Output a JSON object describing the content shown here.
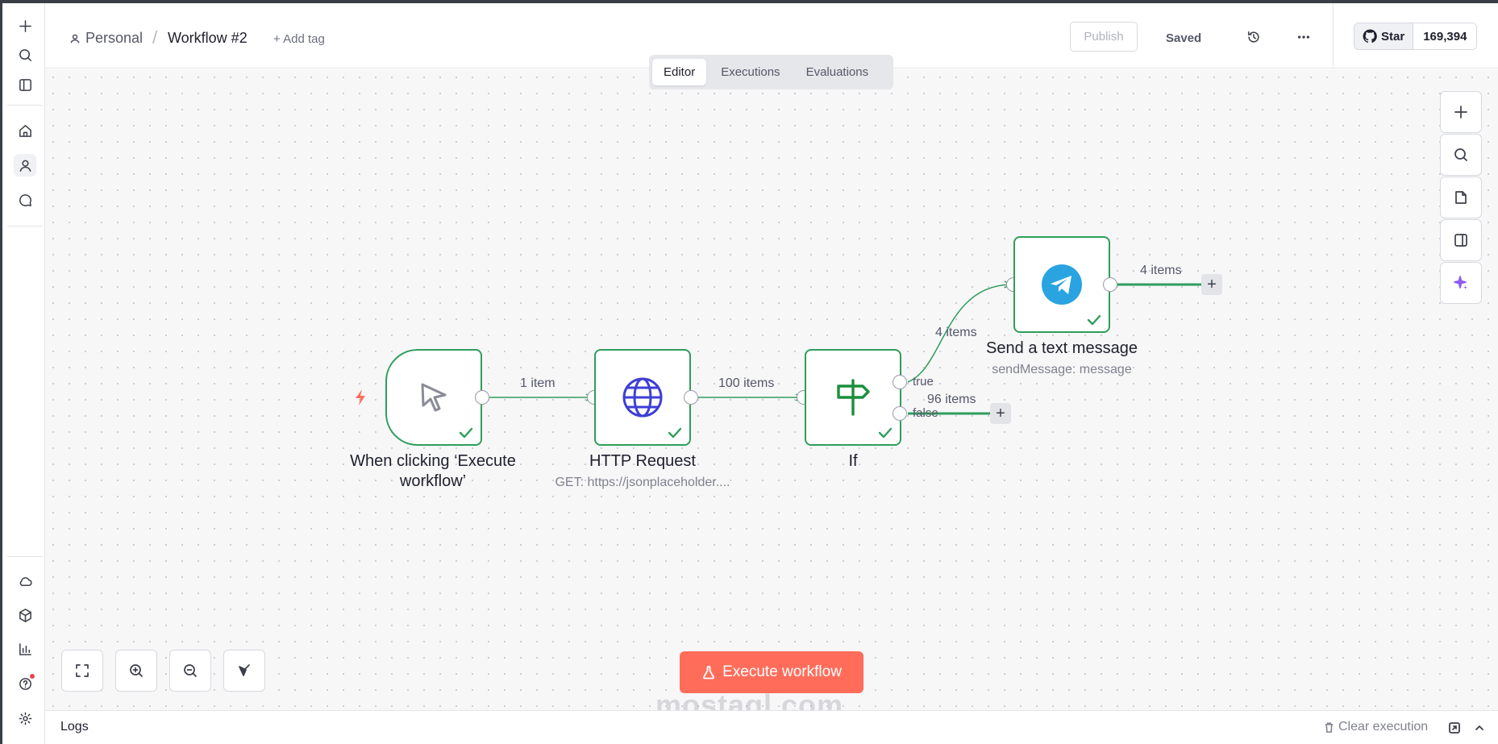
{
  "header": {
    "project": "Personal",
    "separator": "/",
    "workflow_name": "Workflow #2",
    "add_tag": "+ Add tag",
    "publish": "Publish",
    "saved": "Saved"
  },
  "github": {
    "star_label": "Star",
    "star_count": "169,394"
  },
  "tabs": [
    {
      "label": "Editor",
      "active": true
    },
    {
      "label": "Executions",
      "active": false
    },
    {
      "label": "Evaluations",
      "active": false
    }
  ],
  "sidebar": {
    "top": [
      "plus-icon",
      "search-icon",
      "panel-icon"
    ],
    "nav": [
      "home-icon",
      "user-icon",
      "chat-icon"
    ],
    "bottom": [
      "cloud-icon",
      "cube-icon",
      "chart-icon",
      "help-icon",
      "settings-icon"
    ]
  },
  "nodes": {
    "trigger": {
      "title": "When clicking ‘Execute workflow’",
      "icon": "cursor-icon",
      "status": "success"
    },
    "http": {
      "title": "HTTP Request",
      "subtitle": "GET: https://jsonplaceholder....",
      "icon": "globe-icon",
      "status": "success"
    },
    "if": {
      "title": "If",
      "icon": "signpost-icon",
      "status": "success",
      "outputs": [
        "true",
        "false"
      ]
    },
    "telegram": {
      "title": "Send a text message",
      "subtitle": "sendMessage: message",
      "icon": "telegram-icon",
      "status": "success"
    }
  },
  "edges": {
    "trigger_http": "1 item",
    "http_if": "100 items",
    "if_true_telegram": "4 items",
    "if_false": "96 items",
    "telegram_out": "4 items"
  },
  "execute_button": "Execute workflow",
  "watermark": "mostaql.com",
  "logs": {
    "label": "Logs",
    "clear": "Clear execution"
  },
  "colors": {
    "accent": "#ff6d5a",
    "success": "#2e9e5b",
    "telegram": "#2aa4e0",
    "globe": "#3d3fd4",
    "ai": "#8e5cf0"
  }
}
